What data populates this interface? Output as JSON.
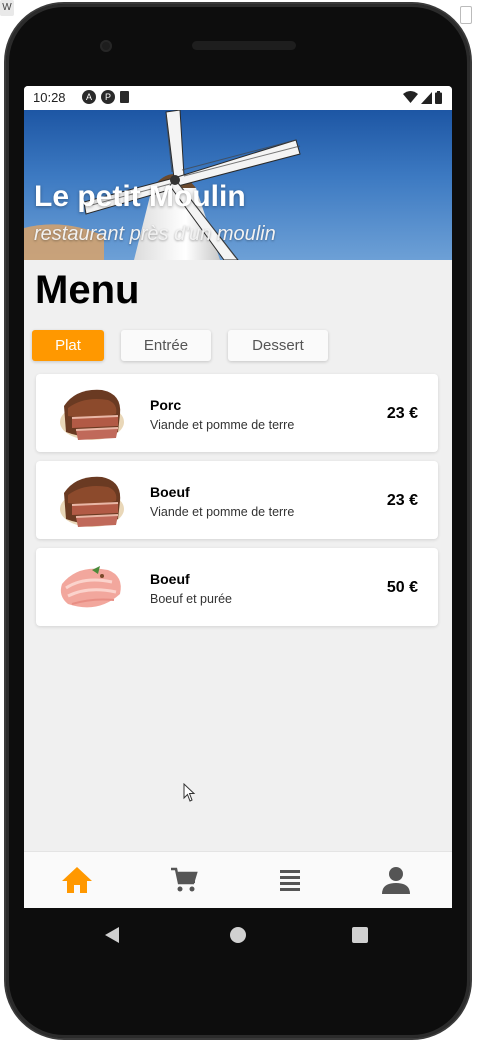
{
  "status_bar": {
    "time": "10:28",
    "left_icons": [
      "a-icon",
      "p-icon",
      "sd-card-icon"
    ],
    "right_icons": [
      "wifi-icon",
      "signal-icon",
      "battery-icon"
    ]
  },
  "hero": {
    "title": "Le petit Moulin",
    "subtitle": "restaurant près d'un moulin"
  },
  "menu": {
    "title": "Menu",
    "tabs": [
      {
        "label": "Plat",
        "active": true
      },
      {
        "label": "Entrée",
        "active": false
      },
      {
        "label": "Dessert",
        "active": false
      }
    ],
    "items": [
      {
        "name": "Porc",
        "description": "Viande et pomme de terre",
        "price": "23 €",
        "image": "grilled-meat-image"
      },
      {
        "name": "Boeuf",
        "description": "Viande et pomme de terre",
        "price": "23 €",
        "image": "grilled-meat-image"
      },
      {
        "name": "Boeuf",
        "description": "Boeuf et purée",
        "price": "50 €",
        "image": "raw-meat-image"
      }
    ]
  },
  "bottom_nav": {
    "items": [
      {
        "icon": "home-icon",
        "active": true
      },
      {
        "icon": "cart-icon",
        "active": false
      },
      {
        "icon": "list-icon",
        "active": false
      },
      {
        "icon": "profile-icon",
        "active": false
      }
    ]
  },
  "colors": {
    "accent": "#ff9800",
    "inactive_icon": "#555555",
    "screen_background": "#f0f0f0"
  }
}
